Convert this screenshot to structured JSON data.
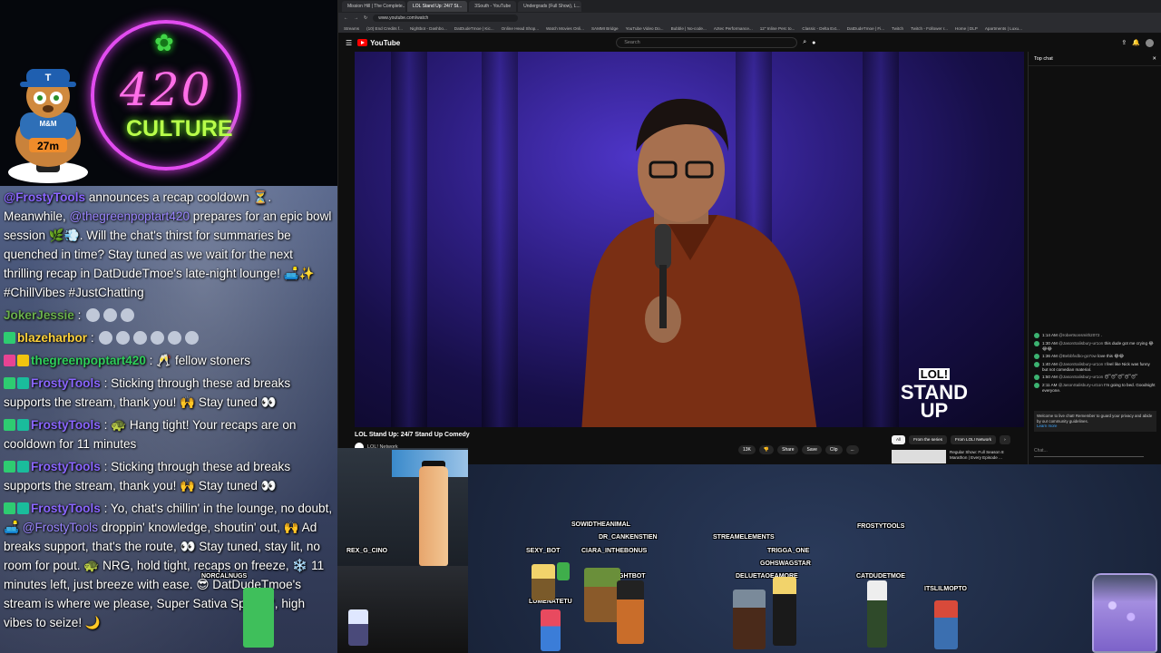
{
  "overlay": {
    "mascot_timer": "27m",
    "mascot_shirt": "M&M",
    "mascot_hat": "T",
    "neon_number": "420",
    "neon_word": "CULTURE",
    "chat": {
      "msg1_user": "@FrostyTools",
      "msg1_a": " announces a recap cooldown ⏳. Meanwhile, ",
      "msg1_mention": "@thegreenpoptart420",
      "msg1_b": " prepares for an epic bowl session 🌿💨. Will the chat's thirst for summaries be quenched in time? Stay tuned as we wait for the next thrilling recap in DatDudeTmoe's late-night lounge! 🛋️✨ #ChillVibes #JustChatting",
      "msg2_user": "JokerJessie",
      "msg2_text": " :",
      "msg3_user": "blazeharbor",
      "msg3_text": " :",
      "msg4_user": "thegreenpoptart420",
      "msg4_text": " : 🥂 fellow stoners",
      "msg5_user": "FrostyTools",
      "msg5_text": " : Sticking through these ad breaks supports the stream, thank you! 🙌 Stay tuned 👀",
      "msg6_user": "FrostyTools",
      "msg6_text": " : 🐢 Hang tight! Your recaps are on cooldown for 11 minutes",
      "msg7_user": "FrostyTools",
      "msg7_text": " : Sticking through these ad breaks supports the stream, thank you! 🙌 Stay tuned 👀",
      "msg8_user": "FrostyTools",
      "msg8_a": " : Yo, chat's chillin' in the lounge, no doubt, 🛋️ ",
      "msg8_mention": "@FrostyTools",
      "msg8_b": " droppin' knowledge, shoutin' out, 🙌 Ad breaks support, that's the route, 👀 Stay tuned, stay lit, no room for pout. 🐢 NRG, hold tight, recaps on freeze, ❄️ 11 minutes left, just breeze with ease. 😎 DatDudeTmoe's stream is where we please, Super Sativa Sparkin', high vibes to seize! 🌙"
    }
  },
  "browser": {
    "tabs": [
      "Mission Hill | The Complete...",
      "LOL Stand Up: 24/7 St...",
      "3South - YouTube",
      "Undergrads (Full Show), L..."
    ],
    "url": "www.youtube.com/watch",
    "bookmarks": [
      "Streams",
      "(10) End Credits f...",
      "Nightbot - Dashbo...",
      "DatDudeTmoe | Kic...",
      "Online Head Shop...",
      "Watch Movies Onli...",
      "SAMMI Bridge",
      "YouTube Video Do...",
      "Bubble | No-code...",
      "Aztec Performance...",
      "12\" Inline Perc to...",
      "Classic - Delta Ext...",
      "DatDudeTmoe | Fi...",
      "Twitch",
      "Twitch - Follower r...",
      "Home | DLP",
      "Apartments | Luxu..."
    ]
  },
  "youtube": {
    "logo": "YouTube",
    "search_placeholder": "Search",
    "video_title": "LOL Stand Up: 24/7 Stand Up Comedy",
    "channel": "LOL! Network",
    "watermark_top": "LOL!",
    "watermark_mid": "STAND",
    "watermark_bot": "UP",
    "actions": [
      "13K",
      "Share",
      "Save",
      "Clip",
      "..."
    ],
    "chips": [
      "All",
      "From the series",
      "From LOL! Network"
    ],
    "rec_title": "Regular Show: Full Season 8 Marathon | Every Episode ...",
    "livechat": {
      "title": "Top chat",
      "msgs": [
        {
          "time": "1:14 AM",
          "name": "@robertsonsmith2072",
          "text": "."
        },
        {
          "time": "1:30 AM",
          "name": "@JasonSalisbury-ur1on",
          "text": "this dude got me crying 😂😂😂"
        },
        {
          "time": "1:36 AM",
          "name": "@Bebbfvdbo-go7ow",
          "text": "love this 😂😂"
        },
        {
          "time": "1:40 AM",
          "name": "@JasonSalisbury-ur1on",
          "text": "I feel like Nick was funny but not comedian material."
        },
        {
          "time": "1:50 AM",
          "name": "@JasonSalisbury-ur1on",
          "text": "😴😴😴😴😴"
        },
        {
          "time": "2:11 AM",
          "name": "@JasonSalisbury-ur1on",
          "text": "I'm going to bed. Goodnight everyone."
        }
      ],
      "welcome": "Welcome to live chat! Remember to guard your privacy and abide by our community guidelines.",
      "learn_more": "Learn more",
      "input_placeholder": "Chat..."
    }
  },
  "scene": {
    "names": [
      "SOWIDTHEANIMAL",
      "DR_CANKENSTIEN",
      "SEXY_BOT",
      "CIARA_INTHEBONUS",
      "STREAMELEMENTS",
      "TRIGGA_ONE",
      "GOHSWAGSTAR",
      "DELUETAOEAMORE",
      "FROSTYTOOLS",
      "CATDUDETMOE",
      "ITSLILMOPTO",
      "LUMENATETU",
      "NIGHTBOT",
      "REX_G_CINO",
      "NORCALNUGS"
    ]
  }
}
